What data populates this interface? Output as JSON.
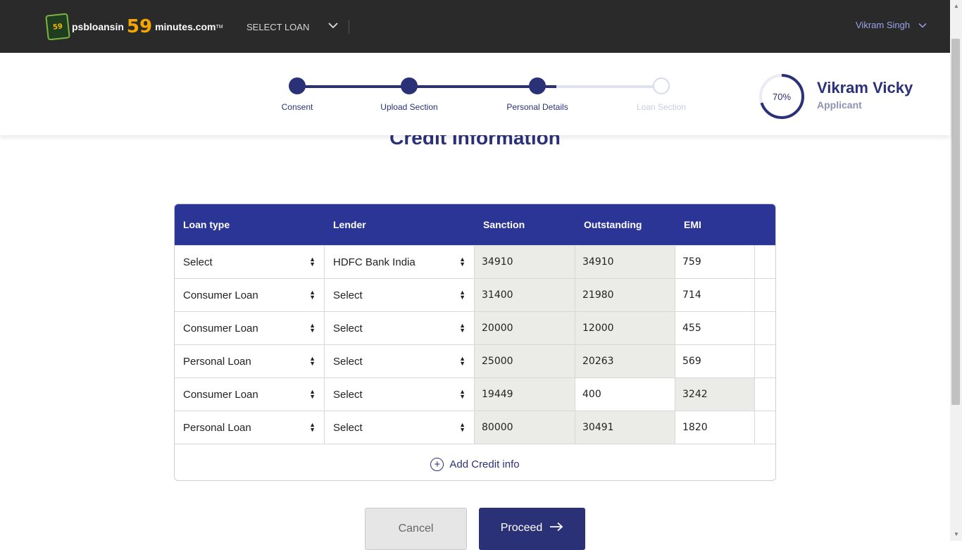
{
  "brand": {
    "mark": "59",
    "part1": "psbloansin",
    "part2": "59",
    "part3": "minutes.com",
    "tm": "TM"
  },
  "nav": {
    "select_loan": "SELECT LOAN",
    "user": "Vikram Singh"
  },
  "steps": [
    {
      "label": "Consent",
      "state": "done"
    },
    {
      "label": "Upload Section",
      "state": "done"
    },
    {
      "label": "Personal Details",
      "state": "current"
    },
    {
      "label": "Loan Section",
      "state": "pending"
    }
  ],
  "profile": {
    "completion_label": "70%",
    "completion": 0.7,
    "name": "Vikram Vicky",
    "role": "Applicant"
  },
  "page_title": "Credit Information",
  "table": {
    "headers": [
      "Loan type",
      "Lender",
      "Sanction",
      "Outstanding",
      "EMI"
    ],
    "rows": [
      {
        "loan_type": "Select",
        "lender": "HDFC Bank India",
        "sanction": "34910",
        "outstanding": "34910",
        "emi": "759"
      },
      {
        "loan_type": "Consumer Loan",
        "lender": "Select",
        "sanction": "31400",
        "outstanding": "21980",
        "emi": "714"
      },
      {
        "loan_type": "Consumer Loan",
        "lender": "Select",
        "sanction": "20000",
        "outstanding": "12000",
        "emi": "455"
      },
      {
        "loan_type": "Personal Loan",
        "lender": "Select",
        "sanction": "25000",
        "outstanding": "20263",
        "emi": "569"
      },
      {
        "loan_type": "Consumer Loan",
        "lender": "Select",
        "sanction": "19449",
        "outstanding": "400",
        "emi": "3242"
      },
      {
        "loan_type": "Personal Loan",
        "lender": "Select",
        "sanction": "80000",
        "outstanding": "30491",
        "emi": "1820"
      }
    ],
    "add_label": "Add Credit info"
  },
  "buttons": {
    "cancel": "Cancel",
    "proceed": "Proceed"
  },
  "colors": {
    "primary": "#2b3177",
    "table_header": "#2b3596",
    "topbar": "#2a2a2a",
    "brand_orange": "#f7a600",
    "disabled_cell": "#ebebe7"
  }
}
